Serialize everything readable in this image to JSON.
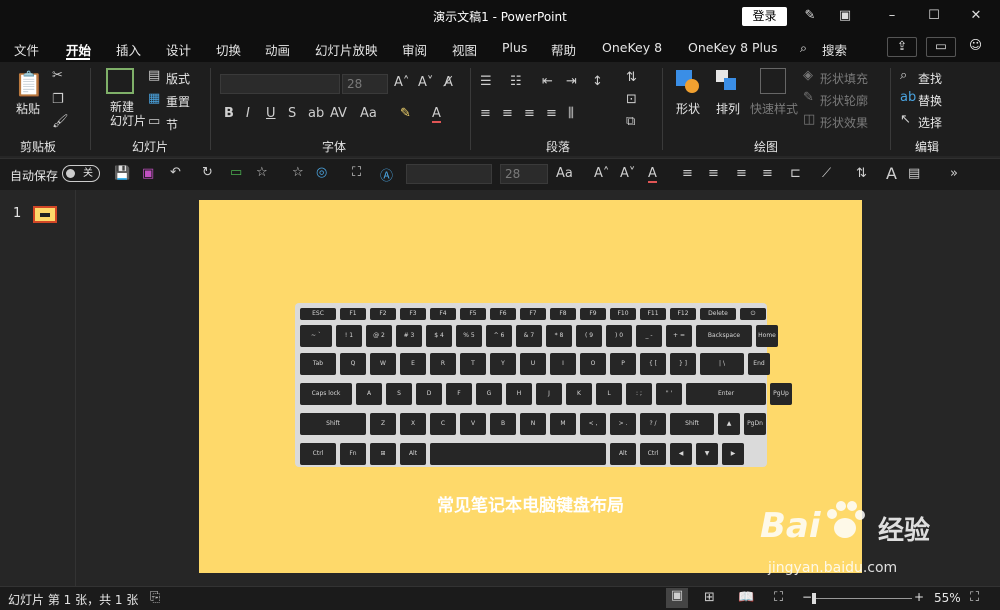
{
  "app": {
    "title": "演示文稿1  -  PowerPoint",
    "login_label": "登录"
  },
  "tabs": [
    {
      "label": "文件"
    },
    {
      "label": "开始"
    },
    {
      "label": "插入"
    },
    {
      "label": "设计"
    },
    {
      "label": "切换"
    },
    {
      "label": "动画"
    },
    {
      "label": "幻灯片放映"
    },
    {
      "label": "审阅"
    },
    {
      "label": "视图"
    },
    {
      "label": "Plus"
    },
    {
      "label": "帮助"
    },
    {
      "label": "OneKey 8"
    },
    {
      "label": "OneKey 8 Plus"
    },
    {
      "label": "搜索"
    }
  ],
  "ribbon": {
    "clipboard": {
      "label": "剪贴板",
      "paste": "粘贴"
    },
    "slides": {
      "label": "幻灯片",
      "new_slide": "新建\n幻灯片",
      "layout": "版式",
      "reset": "重置",
      "section": "节"
    },
    "font": {
      "label": "字体",
      "size": "28"
    },
    "paragraph": {
      "label": "段落"
    },
    "drawing": {
      "label": "绘图",
      "shapes": "形状",
      "arrange": "排列",
      "quick_styles": "快速样式",
      "shape_fill": "形状填充",
      "shape_outline": "形状轮廓",
      "shape_effects": "形状效果"
    },
    "editing": {
      "label": "编辑",
      "find": "查找",
      "replace": "替换",
      "select": "选择"
    }
  },
  "qat": {
    "autosave_label": "自动保存",
    "autosave_state": "关",
    "font_size": "28"
  },
  "thumbnails": [
    {
      "number": "1"
    }
  ],
  "slide": {
    "caption": "常见笔记本电脑键盘布局"
  },
  "keyboard": {
    "rows": [
      [
        "ESC",
        "F1",
        "F2",
        "F3",
        "F4",
        "F5",
        "F6",
        "F7",
        "F8",
        "F9",
        "F10",
        "F11",
        "F12",
        "Delete",
        "⏻"
      ],
      [
        "~ `",
        "! 1",
        "@ 2",
        "# 3",
        "$ 4",
        "% 5",
        "^ 6",
        "& 7",
        "* 8",
        "( 9",
        ") 0",
        "_ -",
        "+ =",
        "Backspace",
        "Home"
      ],
      [
        "Tab",
        "Q",
        "W",
        "E",
        "R",
        "T",
        "Y",
        "U",
        "I",
        "O",
        "P",
        "{ [",
        "} ]",
        "| \\",
        "End"
      ],
      [
        "Caps lock",
        "A",
        "S",
        "D",
        "F",
        "G",
        "H",
        "J",
        "K",
        "L",
        ": ;",
        "\" '",
        "Enter",
        "PgUp"
      ],
      [
        "Shift",
        "Z",
        "X",
        "C",
        "V",
        "B",
        "N",
        "M",
        "< ,",
        "> .",
        "? /",
        "Shift",
        "▲",
        "PgDn"
      ],
      [
        "Ctrl",
        "Fn",
        "⊞",
        "Alt",
        "",
        "Alt",
        "Ctrl",
        "◀",
        "▼",
        "▶"
      ]
    ]
  },
  "status": {
    "slide_info": "幻灯片 第 1 张，共 1 张",
    "zoom": "55%"
  },
  "watermark": {
    "brand": "Bai",
    "brand2": "经验",
    "url": "jingyan.baidu.com"
  }
}
